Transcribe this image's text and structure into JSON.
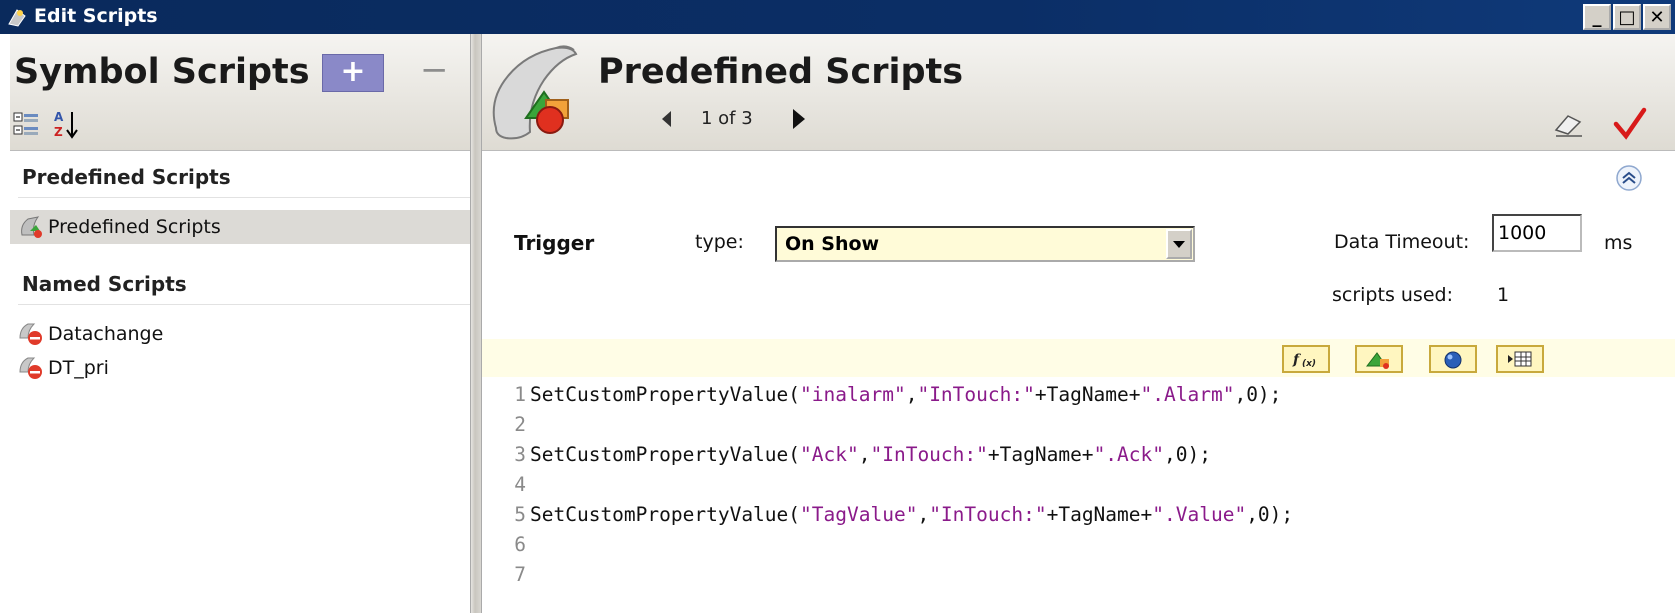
{
  "window": {
    "title": "Edit Scripts",
    "buttons": [
      "_",
      "□",
      "✕"
    ]
  },
  "left": {
    "title": "Symbol Scripts",
    "add_label": "+",
    "remove_label": "−",
    "sections": [
      {
        "header": "Predefined Scripts",
        "items": [
          "Predefined Scripts"
        ]
      },
      {
        "header": "Named Scripts",
        "items": [
          "Datachange",
          "DT_pri"
        ]
      }
    ]
  },
  "right": {
    "title": "Predefined Scripts",
    "pager": "1 of 3",
    "trigger_label": "Trigger",
    "type_label": "type:",
    "type_value": "On Show",
    "timeout_label": "Data Timeout:",
    "timeout_value": "1000",
    "timeout_unit": "ms",
    "scripts_used_label": "scripts used:",
    "scripts_used_value": "1",
    "toolbar_buttons": [
      "f(x)",
      "insert-symbol",
      "object-browser",
      "property-list"
    ]
  },
  "editor": {
    "lines": [
      {
        "n": "1",
        "pre": "SetCustomPropertyValue(",
        "s1": "\"inalarm\"",
        "mid": ",",
        "s2": "\"InTouch:\"",
        "mid2": "+TagName+",
        "s3": "\".Alarm\"",
        "post": ",0);"
      },
      {
        "n": "2"
      },
      {
        "n": "3",
        "pre": "SetCustomPropertyValue(",
        "s1": "\"Ack\"",
        "mid": ",",
        "s2": "\"InTouch:\"",
        "mid2": "+TagName+",
        "s3": "\".Ack\"",
        "post": ",0);"
      },
      {
        "n": "4"
      },
      {
        "n": "5",
        "pre": "SetCustomPropertyValue(",
        "s1": "\"TagValue\"",
        "mid": ",",
        "s2": "\"InTouch:\"",
        "mid2": "+TagName+",
        "s3": "\".Value\"",
        "post": ",0);"
      },
      {
        "n": "6"
      },
      {
        "n": "7"
      }
    ]
  }
}
